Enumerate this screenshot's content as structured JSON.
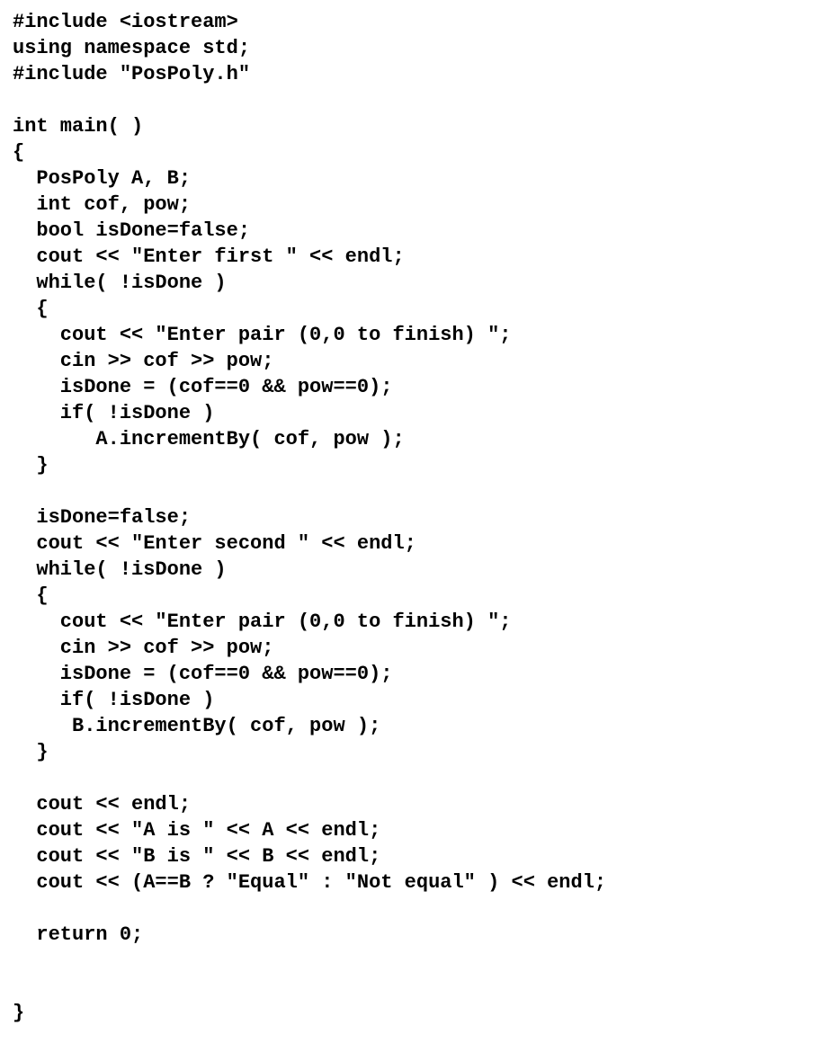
{
  "code": {
    "lines": [
      "#include <iostream>",
      "using namespace std;",
      "#include \"PosPoly.h\"",
      "",
      "int main( )",
      "{",
      "  PosPoly A, B;",
      "  int cof, pow;",
      "  bool isDone=false;",
      "  cout << \"Enter first \" << endl;",
      "  while( !isDone )",
      "  {",
      "    cout << \"Enter pair (0,0 to finish) \";",
      "    cin >> cof >> pow;",
      "    isDone = (cof==0 && pow==0);",
      "    if( !isDone )",
      "       A.incrementBy( cof, pow );",
      "  }",
      "",
      "  isDone=false;",
      "  cout << \"Enter second \" << endl;",
      "  while( !isDone )",
      "  {",
      "    cout << \"Enter pair (0,0 to finish) \";",
      "    cin >> cof >> pow;",
      "    isDone = (cof==0 && pow==0);",
      "    if( !isDone )",
      "     B.incrementBy( cof, pow );",
      "  }",
      "",
      "  cout << endl;",
      "  cout << \"A is \" << A << endl;",
      "  cout << \"B is \" << B << endl;",
      "  cout << (A==B ? \"Equal\" : \"Not equal\" ) << endl;",
      "",
      "  return 0;",
      "",
      "",
      "}"
    ]
  }
}
